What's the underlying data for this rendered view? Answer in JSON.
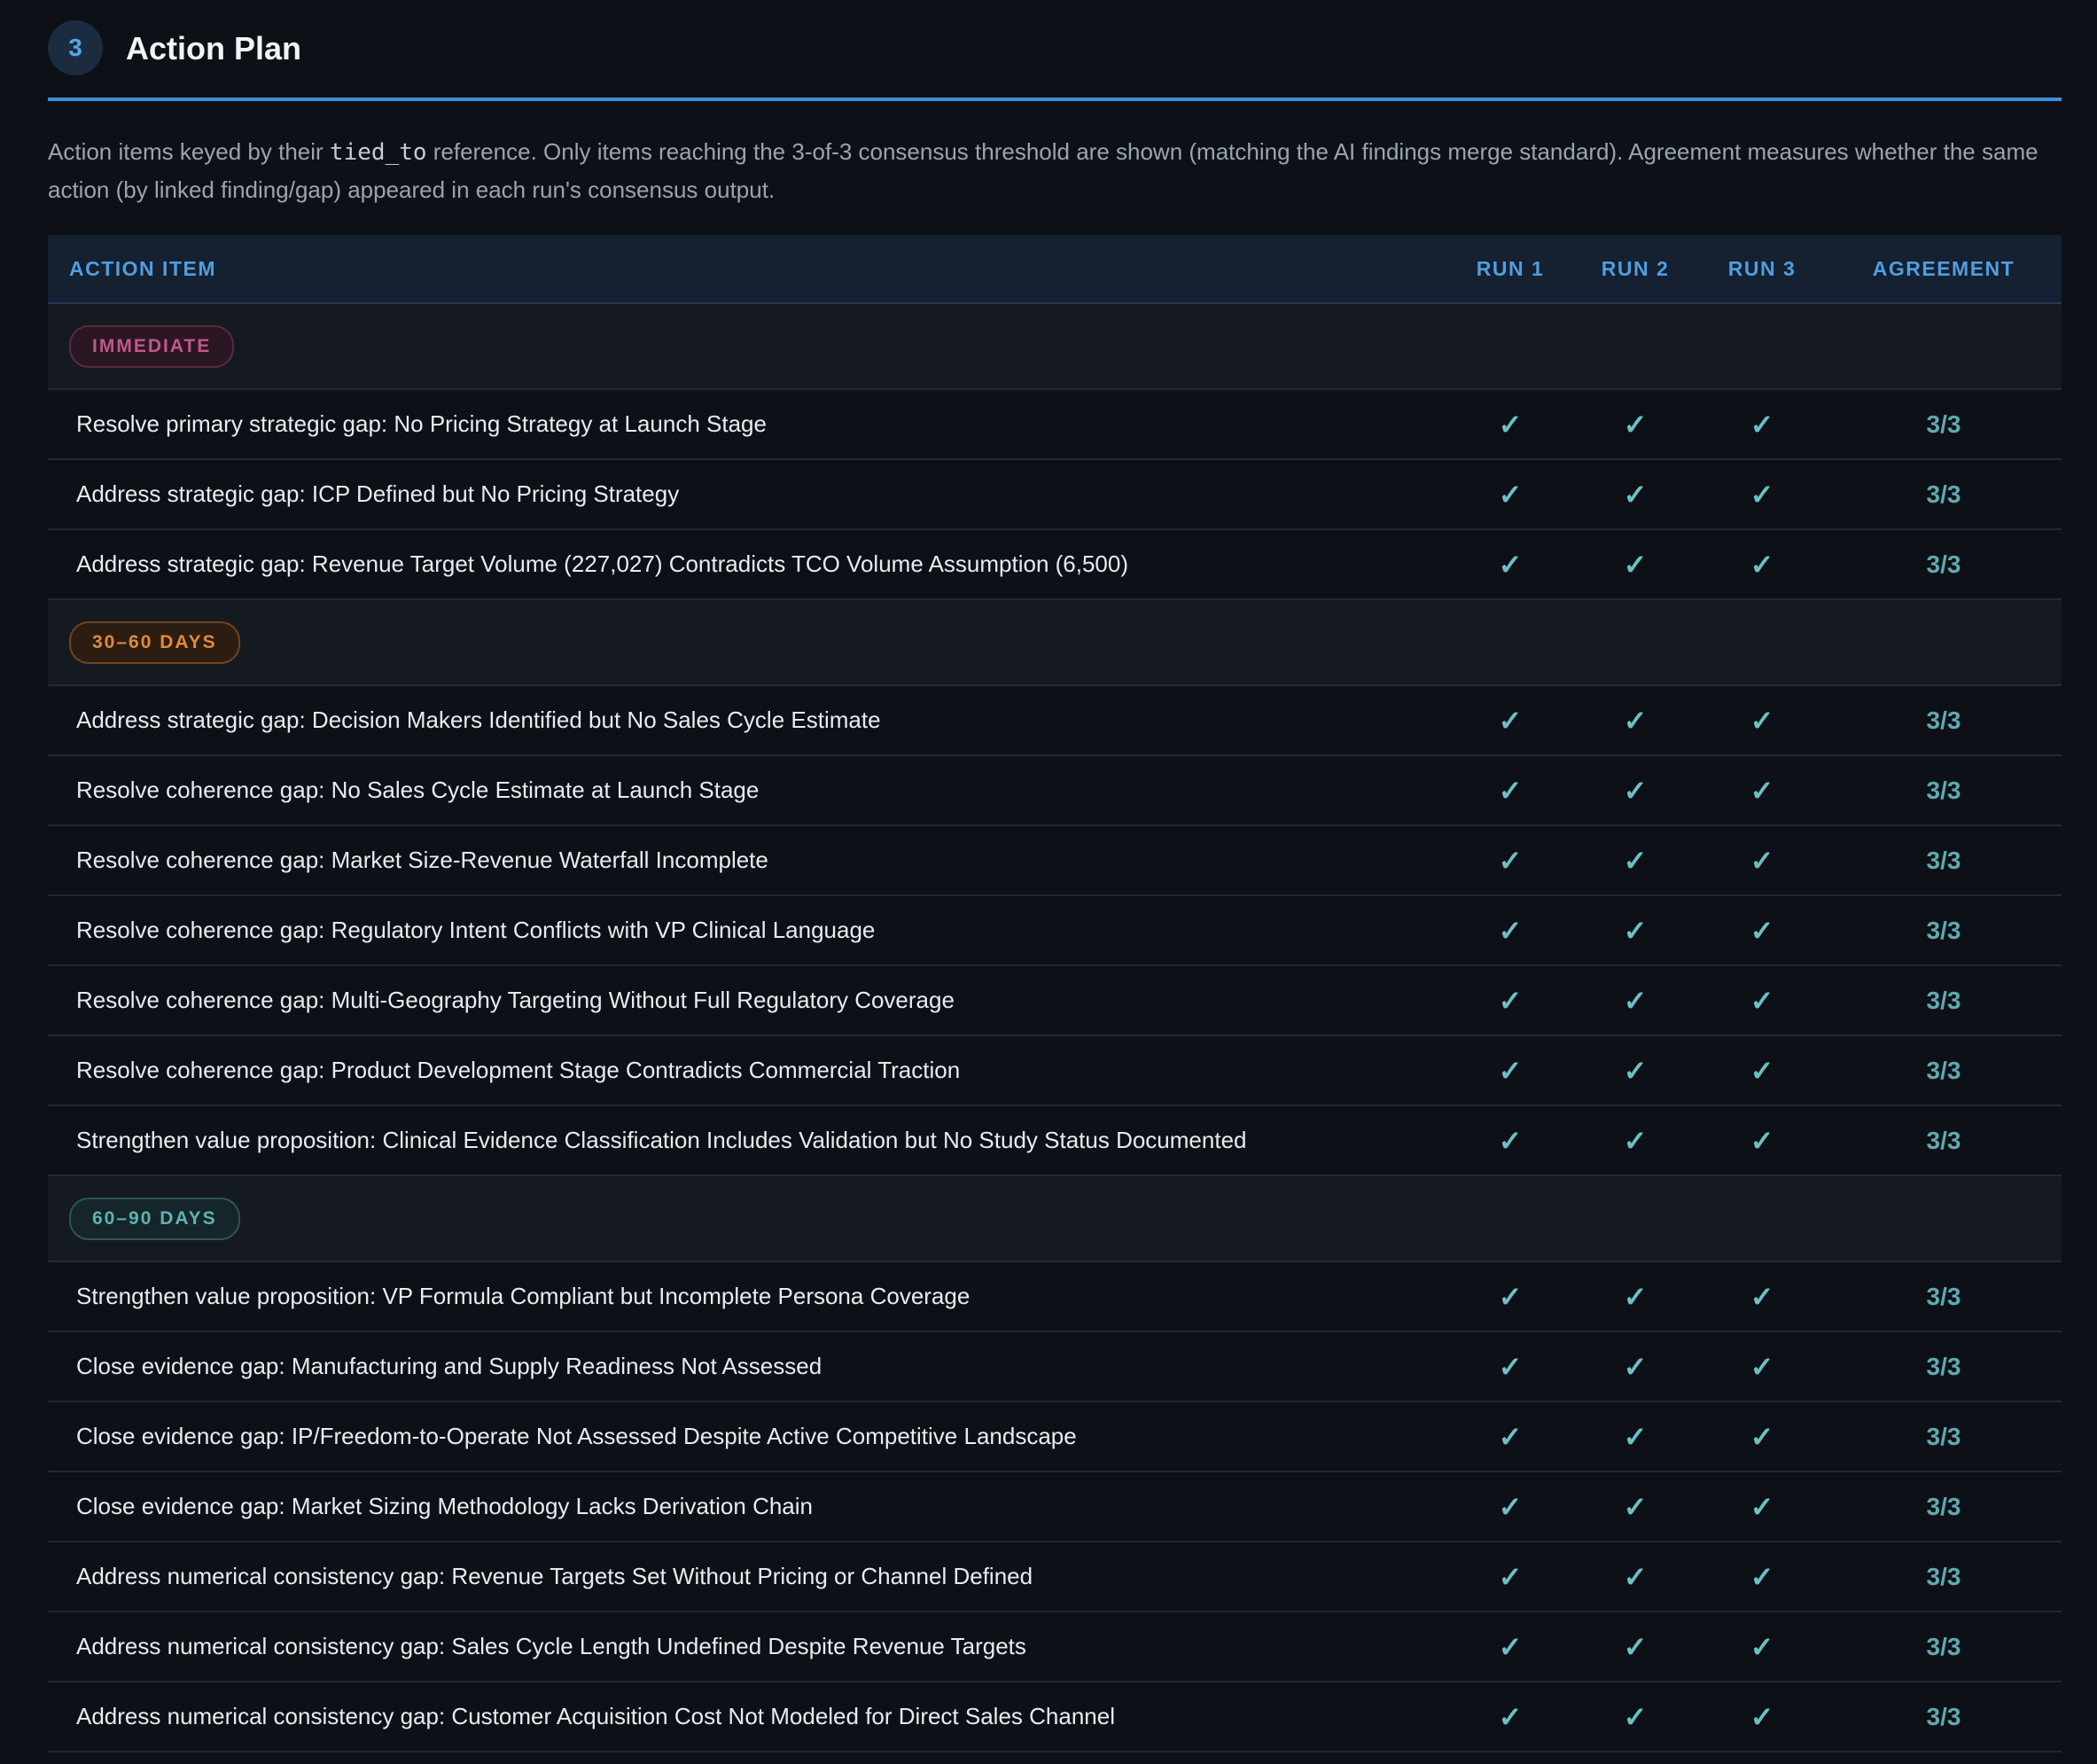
{
  "section": {
    "number": "3",
    "title": "Action Plan"
  },
  "description": {
    "pre": "Action items keyed by their ",
    "code": "tied_to",
    "post": " reference. Only items reaching the 3-of-3 consensus threshold are shown (matching the AI findings merge standard). Agreement measures whether the same action (by linked finding/gap) appeared in each run's consensus output."
  },
  "table": {
    "headers": {
      "action": "ACTION ITEM",
      "run1": "RUN 1",
      "run2": "RUN 2",
      "run3": "RUN 3",
      "agreement": "AGREEMENT"
    },
    "check_symbol": "✓",
    "groups": [
      {
        "label": "IMMEDIATE",
        "style": "immediate",
        "items": [
          {
            "label": "Resolve primary strategic gap: No Pricing Strategy at Launch Stage",
            "agreement": "3/3"
          },
          {
            "label": "Address strategic gap: ICP Defined but No Pricing Strategy",
            "agreement": "3/3"
          },
          {
            "label": "Address strategic gap: Revenue Target Volume (227,027) Contradicts TCO Volume Assumption (6,500)",
            "agreement": "3/3"
          }
        ]
      },
      {
        "label": "30–60 DAYS",
        "style": "d3060",
        "items": [
          {
            "label": "Address strategic gap: Decision Makers Identified but No Sales Cycle Estimate",
            "agreement": "3/3"
          },
          {
            "label": "Resolve coherence gap: No Sales Cycle Estimate at Launch Stage",
            "agreement": "3/3"
          },
          {
            "label": "Resolve coherence gap: Market Size-Revenue Waterfall Incomplete",
            "agreement": "3/3"
          },
          {
            "label": "Resolve coherence gap: Regulatory Intent Conflicts with VP Clinical Language",
            "agreement": "3/3"
          },
          {
            "label": "Resolve coherence gap: Multi-Geography Targeting Without Full Regulatory Coverage",
            "agreement": "3/3"
          },
          {
            "label": "Resolve coherence gap: Product Development Stage Contradicts Commercial Traction",
            "agreement": "3/3"
          },
          {
            "label": "Strengthen value proposition: Clinical Evidence Classification Includes Validation but No Study Status Documented",
            "agreement": "3/3"
          }
        ]
      },
      {
        "label": "60–90 DAYS",
        "style": "d6090",
        "items": [
          {
            "label": "Strengthen value proposition: VP Formula Compliant but Incomplete Persona Coverage",
            "agreement": "3/3"
          },
          {
            "label": "Close evidence gap: Manufacturing and Supply Readiness Not Assessed",
            "agreement": "3/3"
          },
          {
            "label": "Close evidence gap: IP/Freedom-to-Operate Not Assessed Despite Active Competitive Landscape",
            "agreement": "3/3"
          },
          {
            "label": "Close evidence gap: Market Sizing Methodology Lacks Derivation Chain",
            "agreement": "3/3"
          },
          {
            "label": "Address numerical consistency gap: Revenue Targets Set Without Pricing or Channel Defined",
            "agreement": "3/3"
          },
          {
            "label": "Address numerical consistency gap: Sales Cycle Length Undefined Despite Revenue Targets",
            "agreement": "3/3"
          },
          {
            "label": "Address numerical consistency gap: Customer Acquisition Cost Not Modeled for Direct Sales Channel",
            "agreement": "3/3"
          }
        ]
      }
    ]
  }
}
